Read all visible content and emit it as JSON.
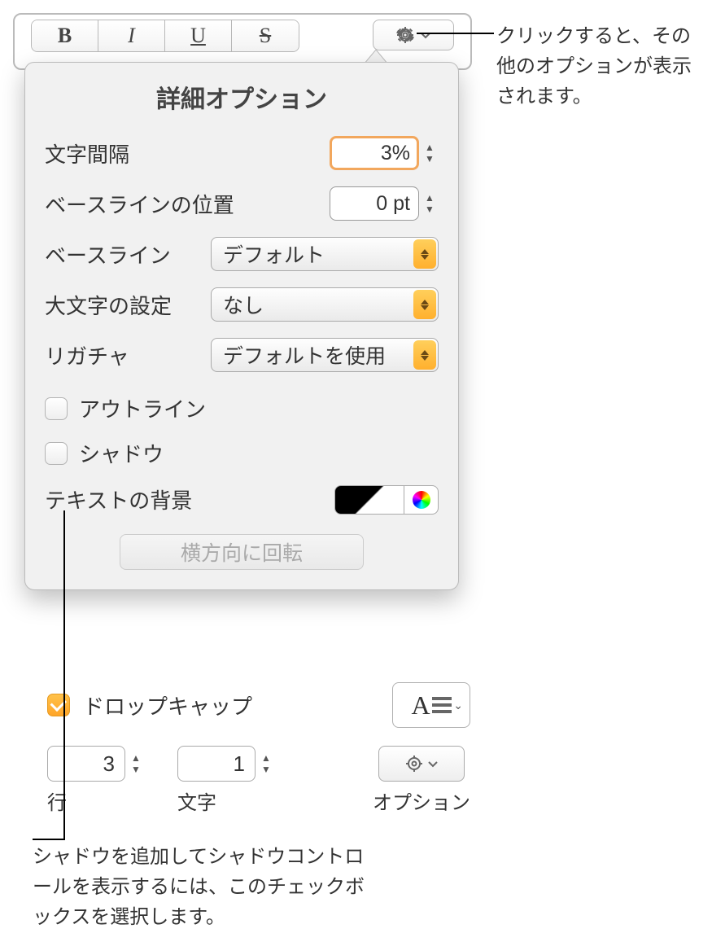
{
  "toolbar": {
    "bold_glyph": "B",
    "italic_glyph": "I",
    "underline_glyph": "U",
    "strike_glyph": "S"
  },
  "annotations": {
    "gear_callout": "クリックすると、その他のオプションが表示されます。",
    "shadow_callout": "シャドウを追加してシャドウコントロールを表示するには、このチェックボックスを選択します。"
  },
  "popover": {
    "title": "詳細オプション",
    "char_spacing": {
      "label": "文字間隔",
      "value": "3%"
    },
    "baseline_shift": {
      "label": "ベースラインの位置",
      "value": "0 pt"
    },
    "baseline": {
      "label": "ベースライン",
      "value": "デフォルト"
    },
    "capitalization": {
      "label": "大文字の設定",
      "value": "なし"
    },
    "ligatures": {
      "label": "リガチャ",
      "value": "デフォルトを使用"
    },
    "outline_label": "アウトライン",
    "shadow_label": "シャドウ",
    "text_bg_label": "テキストの背景",
    "rotate_label": "横方向に回転"
  },
  "dropcap": {
    "label": "ドロップキャップ",
    "preview_glyph": "A",
    "lines_value": "3",
    "lines_label": "行",
    "chars_value": "1",
    "chars_label": "文字",
    "options_label": "オプション"
  }
}
